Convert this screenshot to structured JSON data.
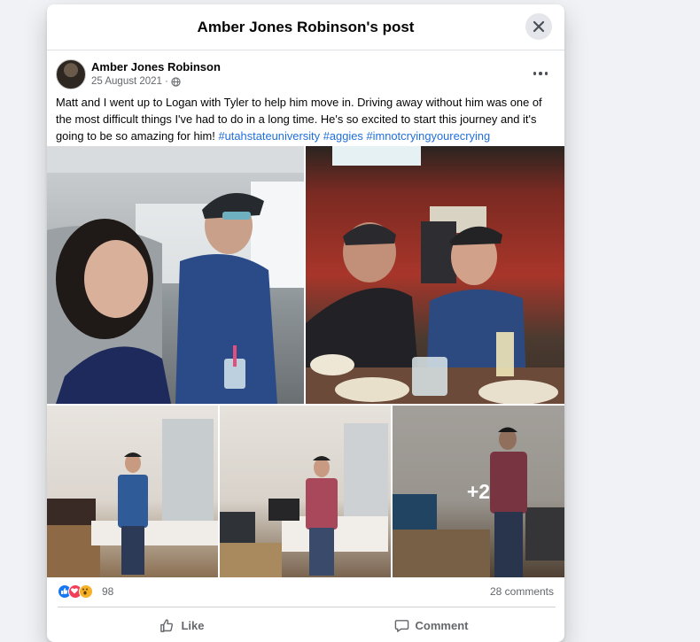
{
  "modal": {
    "title": "Amber Jones Robinson's post"
  },
  "post": {
    "author": "Amber Jones Robinson",
    "date": "25 August 2021",
    "separator": "·",
    "text_plain": "Matt and I went up to Logan with Tyler to help him move in. Driving away without him was one of the most difficult things I've had to do in a long time. He's so excited to start this journey and it's going to be so amazing for him! ",
    "hashtags": [
      "#utahstateuniversity",
      "#aggies",
      "#imnotcryingyourecrying"
    ],
    "extra_photos": "+2",
    "reaction_count": "98",
    "comment_count": "28 comments"
  },
  "actions": {
    "like_label": "Like",
    "comment_label": "Comment"
  },
  "icons": {
    "close": "close-icon",
    "globe": "globe-icon",
    "more": "more-options-icon",
    "like": "thumbs-up-icon",
    "comment": "comment-bubble-icon",
    "reactions": [
      "like-reaction-icon",
      "love-reaction-icon",
      "wow-reaction-icon"
    ]
  },
  "colors": {
    "link": "#216fdb",
    "like_reaction": "#1877f2",
    "love_reaction": "#f33e58",
    "wow_reaction": "#f7b125"
  }
}
